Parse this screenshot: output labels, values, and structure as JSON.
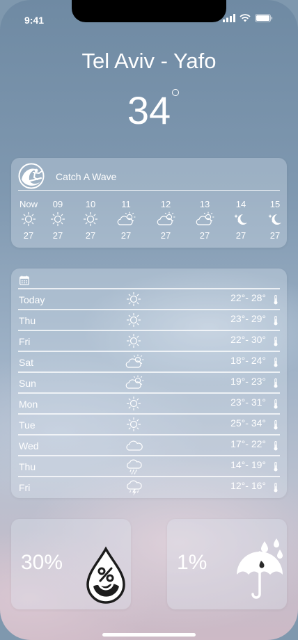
{
  "status_bar": {
    "time": "9:41"
  },
  "location": {
    "city": "Tel Aviv - Yafo",
    "temperature": "34"
  },
  "hourly": {
    "title": "Catch A Wave",
    "items": [
      {
        "label": "Now",
        "icon": "sun-icon",
        "temp": "27"
      },
      {
        "label": "09",
        "icon": "sun-icon",
        "temp": "27"
      },
      {
        "label": "10",
        "icon": "sun-icon",
        "temp": "27"
      },
      {
        "label": "11",
        "icon": "partly-cloudy-icon",
        "temp": "27"
      },
      {
        "label": "12",
        "icon": "partly-cloudy-icon",
        "temp": "27"
      },
      {
        "label": "13",
        "icon": "partly-cloudy-icon",
        "temp": "27"
      },
      {
        "label": "14",
        "icon": "moon-stars-icon",
        "temp": "27"
      },
      {
        "label": "15",
        "icon": "moon-stars-icon",
        "temp": "27"
      }
    ]
  },
  "daily": [
    {
      "day": "Today",
      "icon": "sun-icon",
      "range": "22°- 28°"
    },
    {
      "day": "Thu",
      "icon": "sun-icon",
      "range": "23°- 29°"
    },
    {
      "day": "Fri",
      "icon": "sun-icon",
      "range": "22°- 30°"
    },
    {
      "day": "Sat",
      "icon": "partly-cloudy-icon",
      "range": "18°- 24°"
    },
    {
      "day": "Sun",
      "icon": "partly-cloudy-icon",
      "range": "19°- 23°"
    },
    {
      "day": "Mon",
      "icon": "sun-icon",
      "range": "23°- 31°"
    },
    {
      "day": "Tue",
      "icon": "sun-icon",
      "range": "25°- 34°"
    },
    {
      "day": "Wed",
      "icon": "cloud-icon",
      "range": "17°- 22°"
    },
    {
      "day": "Thu",
      "icon": "rain-cloud-icon",
      "range": "14°- 19°"
    },
    {
      "day": "Fri",
      "icon": "thunderstorm-icon",
      "range": "12°- 16°"
    }
  ],
  "humidity": {
    "value": "30%",
    "icon": "humidity-drop-icon"
  },
  "rain": {
    "value": "1%",
    "icon": "umbrella-rain-icon"
  }
}
